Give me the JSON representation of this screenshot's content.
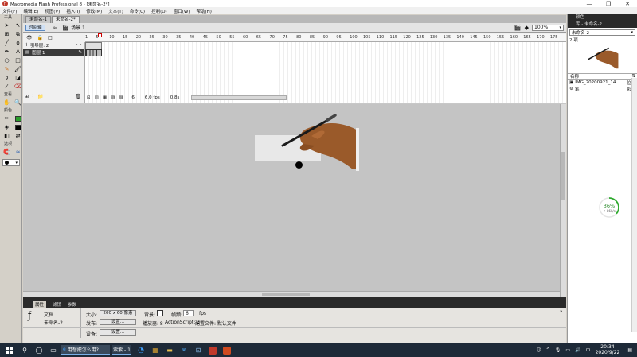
{
  "window": {
    "title": "Macromedia Flash Professional 8 - [未命名-2*]",
    "controls": [
      "—",
      "❐",
      "✕"
    ]
  },
  "menu": [
    "文件(F)",
    "编辑(E)",
    "视图(V)",
    "插入(I)",
    "修改(M)",
    "文本(T)",
    "命令(C)",
    "控制(O)",
    "窗口(W)",
    "帮助(H)"
  ],
  "tools": {
    "title": "工具",
    "view_label": "查看",
    "colors_label": "颜色",
    "options_label": "选项"
  },
  "doc_tabs": [
    "未命名-1",
    "未命名-2*"
  ],
  "editbar": {
    "timeline_btn": "时间轴",
    "scene": "场景 1",
    "zoom": "100%"
  },
  "timeline": {
    "ruler_labels": [
      "1",
      "5",
      "10",
      "15",
      "20",
      "25",
      "30",
      "35",
      "40",
      "45",
      "50",
      "55",
      "60",
      "65",
      "70",
      "75",
      "80",
      "85",
      "90",
      "95",
      "100",
      "105",
      "110",
      "115",
      "120",
      "125",
      "130",
      "135",
      "140",
      "145",
      "150",
      "155",
      "160",
      "165",
      "170",
      "175"
    ],
    "layers": [
      {
        "name": "引导层: 2",
        "selected": false
      },
      {
        "name": "图层 1",
        "selected": true
      }
    ],
    "status": {
      "frame": "6",
      "fps": "6.0 fps",
      "time": "0.8s"
    }
  },
  "props": {
    "tabs": [
      "属性",
      "滤镜",
      "参数"
    ],
    "doc_label": "文档",
    "doc_name": "未命名-2",
    "size_label": "大小:",
    "size_value": "200 x 60 像素",
    "bg_label": "背景:",
    "fps_label": "帧频:",
    "fps_value": "6",
    "fps_unit": "fps",
    "publish_label": "发布:",
    "settings_btn": "设置...",
    "player_label": "播放器: 8",
    "as_label": "ActionScript: 2",
    "profile_label": "配置文件: 默认文件",
    "device_label": "设备:",
    "device_btn": "设置..."
  },
  "right_panel": {
    "color_head": "颜色",
    "library_head": "库 - 未命名-2",
    "library_select": "未命名-2",
    "count": "2 项",
    "name_col": "名称",
    "items": [
      {
        "name": "IMG_20200921_14...",
        "type": "位图"
      },
      {
        "name": "笔",
        "type": "影片"
      }
    ]
  },
  "progress": {
    "percent": "36",
    "percent_label": "36%",
    "rate": "↑ 86k/s"
  },
  "taskbar": {
    "apps": [
      "用想把怎么用?",
      "索索 - 1"
    ],
    "time": "20:34",
    "date": "2020/9/22",
    "ime": "中"
  },
  "colors": {
    "accent": "#3a7bd5",
    "playhead": "#cc0000",
    "progress_ring": "#2eaa2e"
  }
}
